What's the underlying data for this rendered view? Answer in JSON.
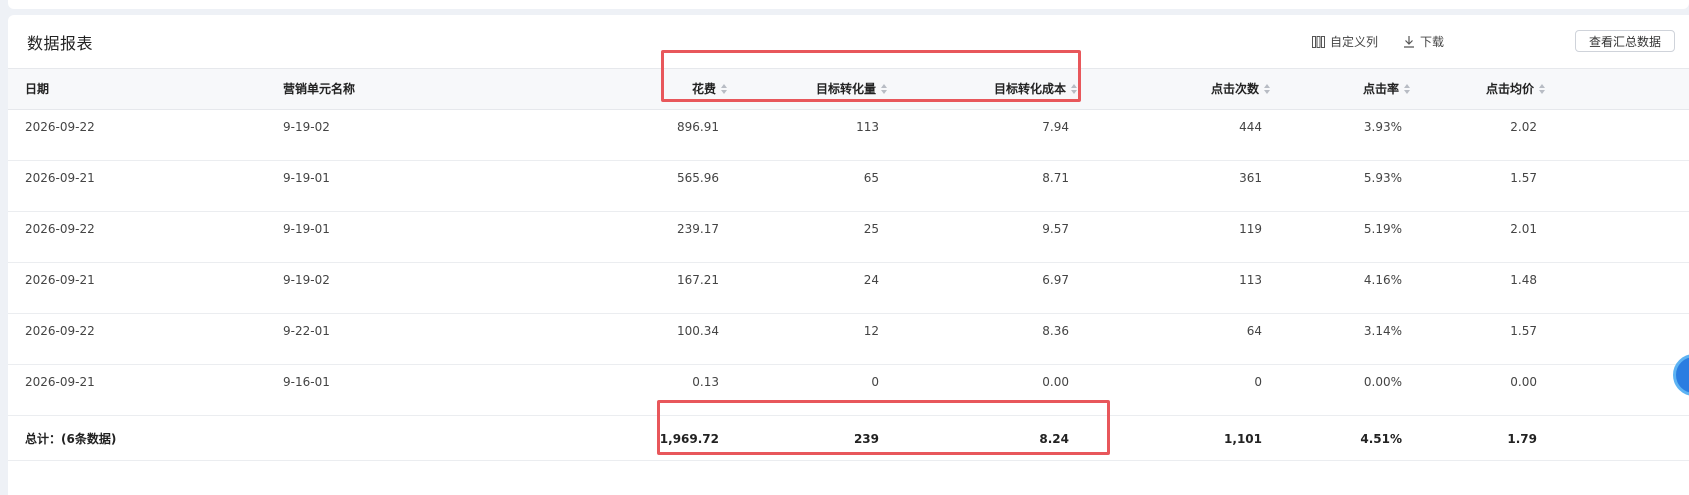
{
  "header": {
    "title": "数据报表",
    "custom_columns_label": "自定义列",
    "download_label": "下载",
    "summary_button_label": "查看汇总数据"
  },
  "table": {
    "columns": [
      "日期",
      "营销单元名称",
      "花费",
      "目标转化量",
      "目标转化成本",
      "点击次数",
      "点击率",
      "点击均价"
    ],
    "rows": [
      [
        "2026-09-22",
        "9-19-02",
        "896.91",
        "113",
        "7.94",
        "444",
        "3.93%",
        "2.02"
      ],
      [
        "2026-09-21",
        "9-19-01",
        "565.96",
        "65",
        "8.71",
        "361",
        "5.93%",
        "1.57"
      ],
      [
        "2026-09-22",
        "9-19-01",
        "239.17",
        "25",
        "9.57",
        "119",
        "5.19%",
        "2.01"
      ],
      [
        "2026-09-21",
        "9-19-02",
        "167.21",
        "24",
        "6.97",
        "113",
        "4.16%",
        "1.48"
      ],
      [
        "2026-09-22",
        "9-22-01",
        "100.34",
        "12",
        "8.36",
        "64",
        "3.14%",
        "1.57"
      ],
      [
        "2026-09-21",
        "9-16-01",
        "0.13",
        "0",
        "0.00",
        "0",
        "0.00%",
        "0.00"
      ]
    ],
    "total": {
      "label": "总计：(6条数据)",
      "cost": "1,969.72",
      "conversions": "239",
      "conversion_cost": "8.24",
      "clicks": "1,101",
      "ctr": "4.51%",
      "cpc": "1.79"
    }
  },
  "colors": {
    "highlight_border": "#e8575b",
    "header_bg": "#f7f8fa",
    "page_bg": "#eef1f6"
  }
}
